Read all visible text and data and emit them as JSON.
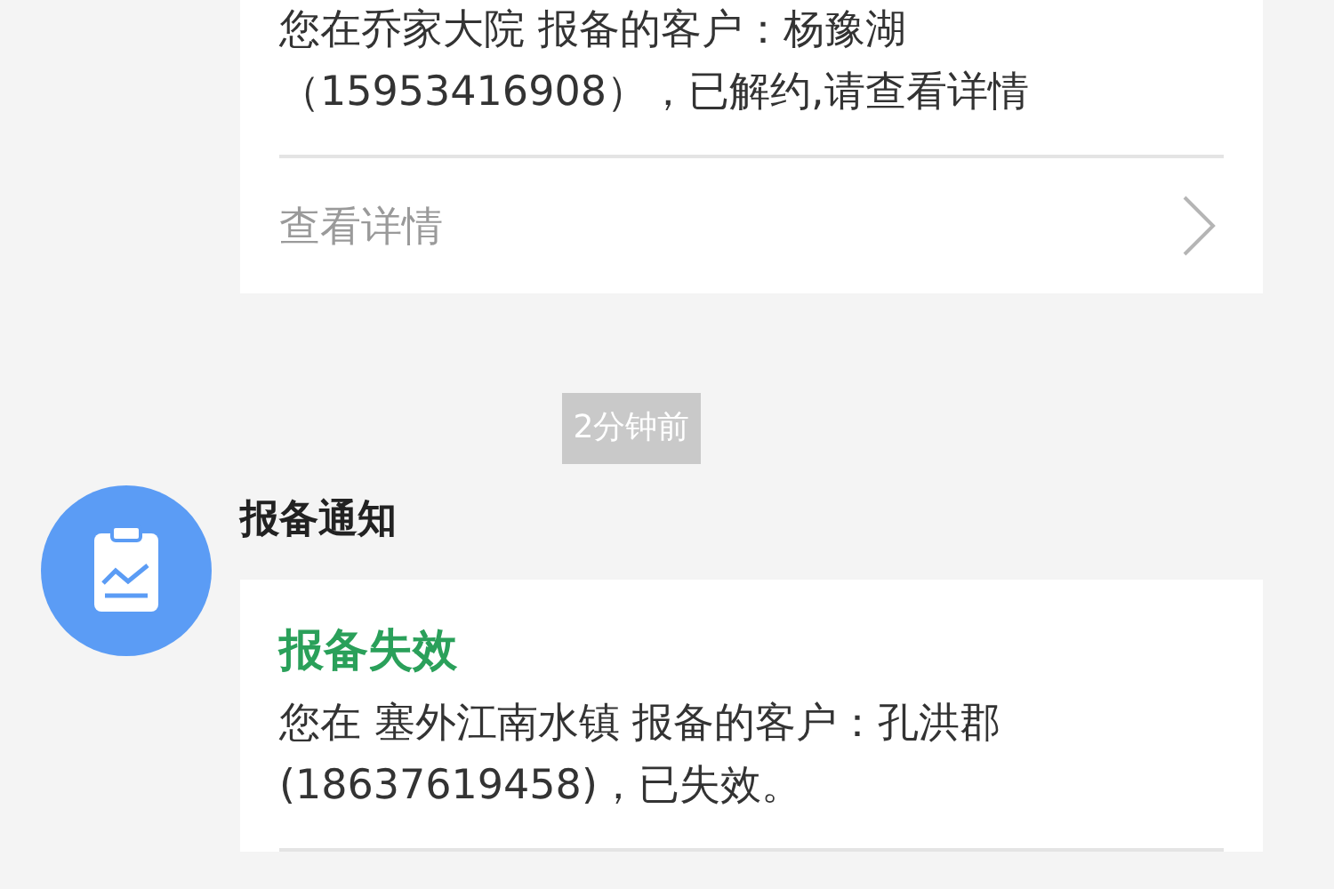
{
  "feed": [
    {
      "kind": "card",
      "card": {
        "lines": [
          "您在乔家大院 报备的客户：杨豫湖",
          "（15953416908），已解约,请查看详情"
        ],
        "action": "查看详情"
      }
    },
    {
      "kind": "time",
      "text": "2分钟前"
    },
    {
      "kind": "notice",
      "title": "报备通知",
      "card": {
        "status": "报备失效",
        "lines": [
          "您在 塞外江南水镇 报备的客户：孔洪郡",
          "(18637619458)，已失效。"
        ]
      }
    }
  ]
}
